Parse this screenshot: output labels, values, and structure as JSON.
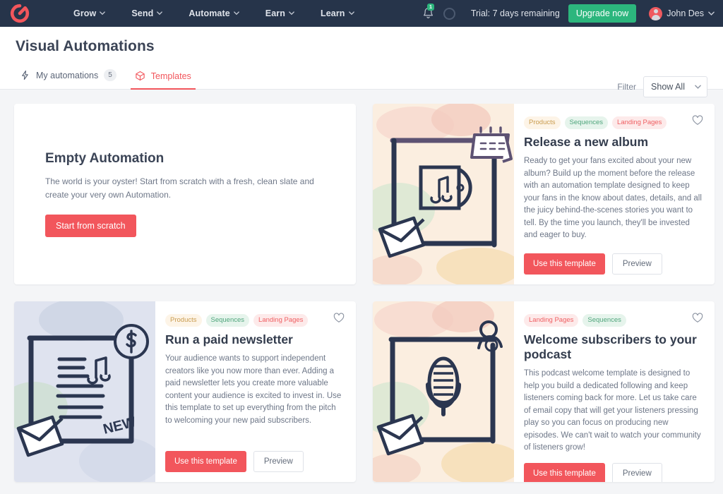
{
  "navbar": {
    "logo_name": "convertkit-logo",
    "links": [
      {
        "label": "Grow"
      },
      {
        "label": "Send"
      },
      {
        "label": "Automate"
      },
      {
        "label": "Earn"
      },
      {
        "label": "Learn"
      }
    ],
    "notification_count": "1",
    "trial_text": "Trial: 7 days remaining",
    "upgrade_label": "Upgrade now",
    "user_name": "John Des"
  },
  "header": {
    "title": "Visual Automations",
    "tabs": [
      {
        "label": "My automations",
        "badge": "5",
        "active": false
      },
      {
        "label": "Templates",
        "badge": "",
        "active": true
      }
    ],
    "filter_label": "Filter",
    "filter_value": "Show All"
  },
  "empty_card": {
    "title": "Empty Automation",
    "description": "The world is your oyster! Start from scratch with a fresh, clean slate and create your very own Automation.",
    "button_label": "Start from scratch"
  },
  "buttons": {
    "use_template": "Use this template",
    "preview": "Preview"
  },
  "templates": [
    {
      "id": "release-a-new-album",
      "illustration": "album-cd-calendar-envelope",
      "tags": [
        "Products",
        "Sequences",
        "Landing Pages"
      ],
      "title": "Release a new album",
      "description": "Ready to get your fans excited about your new album? Build up the moment before the release with an automation template designed to keep your fans in the know about dates, details, and all the juicy behind-the-scenes stories you want to tell. By the time you launch, they'll be invested and eager to buy."
    },
    {
      "id": "run-a-paid-newsletter",
      "illustration": "newsletter-dollar-new-envelope",
      "tags": [
        "Products",
        "Sequences",
        "Landing Pages"
      ],
      "title": "Run a paid newsletter",
      "description": "Your audience wants to support independent creators like you now more than ever. Adding a paid newsletter lets you create more valuable content your audience is excited to invest in. Use this template to set up everything from the pitch to welcoming your new paid subscribers."
    },
    {
      "id": "welcome-subscribers-to-your-podcast",
      "illustration": "microphone-person-envelope",
      "tags": [
        "Landing Pages",
        "Sequences"
      ],
      "title": "Welcome subscribers to your podcast",
      "description": "This podcast welcome template is designed to help you build a dedicated following and keep listeners coming back for more. Let us take care of email copy that will get your listeners pressing play so you can focus on producing new episodes. We can't wait to watch your community of listeners grow!"
    }
  ],
  "colors": {
    "navbar_bg": "#26344a",
    "accent_red": "#f2565c",
    "accent_green": "#2cb67d",
    "page_bg": "#f4f5f7"
  }
}
